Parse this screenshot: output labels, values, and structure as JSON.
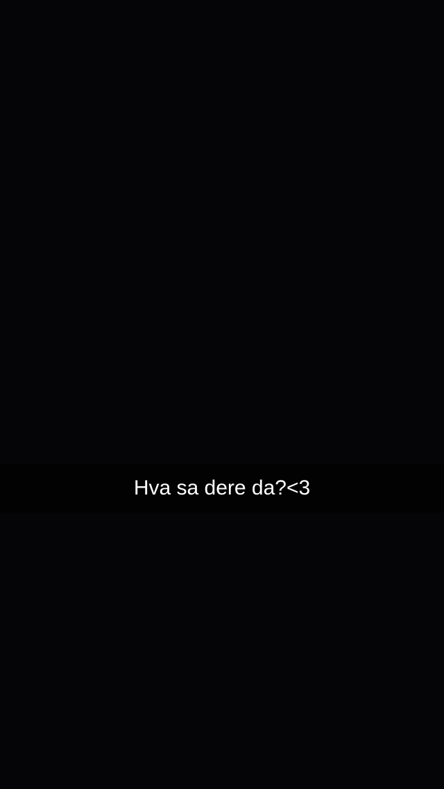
{
  "caption": {
    "text": "Hva sa dere da?<3"
  }
}
